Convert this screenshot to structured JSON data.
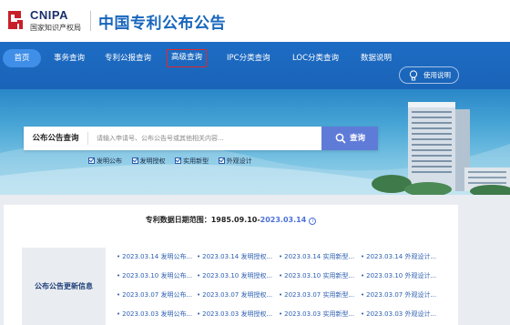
{
  "header": {
    "logo_en": "CNIPA",
    "logo_cn": "国家知识产权局",
    "site_title": "中国专利公布公告"
  },
  "nav": {
    "items": [
      "首页",
      "事务查询",
      "专利公报查询",
      "高级查询",
      "IPC分类查询",
      "LOC分类查询",
      "数据说明"
    ],
    "help": "使用说明"
  },
  "search": {
    "label": "公布公告查询",
    "placeholder": "请输入申请号、公布公告号或其他相关内容...",
    "button": "查询",
    "options": [
      "发明公布",
      "发明授权",
      "实用新型",
      "外观设计"
    ]
  },
  "range": {
    "prefix": "专利数据日期范围：",
    "start": "1985.09.10",
    "dash": "-",
    "end": "2023.03.14",
    "info": "i"
  },
  "updates": {
    "label": "公布公告更新信息",
    "rows": [
      [
        "2023.03.14 发明公布...",
        "2023.03.14 发明授权...",
        "2023.03.14 实用新型...",
        "2023.03.14 外观设计..."
      ],
      [
        "2023.03.10 发明公布...",
        "2023.03.10 发明授权...",
        "2023.03.10 实用新型...",
        "2023.03.10 外观设计..."
      ],
      [
        "2023.03.07 发明公布...",
        "2023.03.07 发明授权...",
        "2023.03.07 实用新型...",
        "2023.03.07 外观设计..."
      ],
      [
        "2023.03.03 发明公布...",
        "2023.03.03 发明授权...",
        "2023.03.03 实用新型...",
        "2023.03.03 外观设计..."
      ]
    ]
  },
  "colors": {
    "nav_bg": "#1a64b8",
    "accent": "#4a70d9",
    "search_button": "#5f7bd8",
    "highlight_border": "#e02a2a"
  }
}
